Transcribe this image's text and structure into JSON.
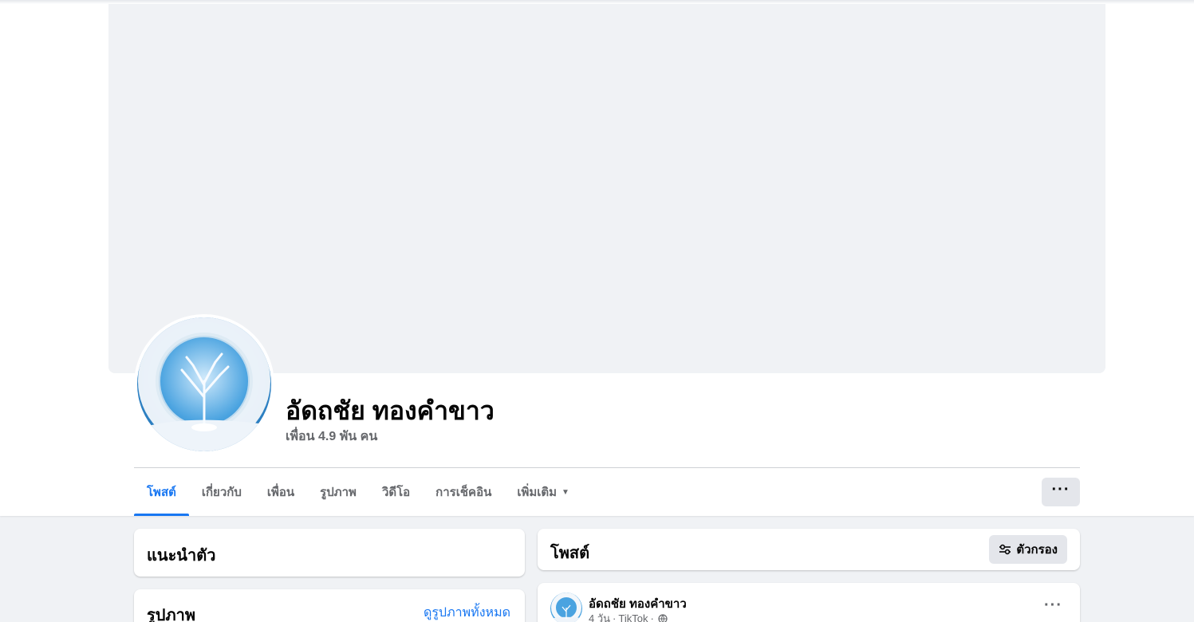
{
  "profile": {
    "name": "อัดถชัย ทองคำขาว",
    "friends": "เพื่อน 4.9 พัน คน"
  },
  "tabs": [
    {
      "label": "โพสต์"
    },
    {
      "label": "เกี่ยวกับ"
    },
    {
      "label": "เพื่อน"
    },
    {
      "label": "รูปภาพ"
    },
    {
      "label": "วิดีโอ"
    },
    {
      "label": "การเช็คอิน"
    },
    {
      "label": "เพิ่มเติม"
    }
  ],
  "more_button": "···",
  "intro": {
    "title": "แนะนำตัว"
  },
  "photos": {
    "title": "รูปภาพ",
    "see_all": "ดูรูปภาพทั้งหมด"
  },
  "posts": {
    "title": "โพสต์",
    "filter_label": "ตัวกรอง"
  },
  "post": {
    "author": "อัดถชัย ทองคำขาว",
    "time": "4 วัน",
    "source": "TikTok",
    "separator": "·",
    "more": "···"
  },
  "colors": {
    "accent": "#1877f2",
    "background": "#f0f2f5",
    "secondary_text": "#65676b",
    "button_gray": "#e4e6eb"
  },
  "icons": {
    "avatar": "winter-tree-avatar",
    "filter": "filter-sliders-icon",
    "privacy": "globe-icon",
    "dropdown": "caret-down-icon"
  }
}
